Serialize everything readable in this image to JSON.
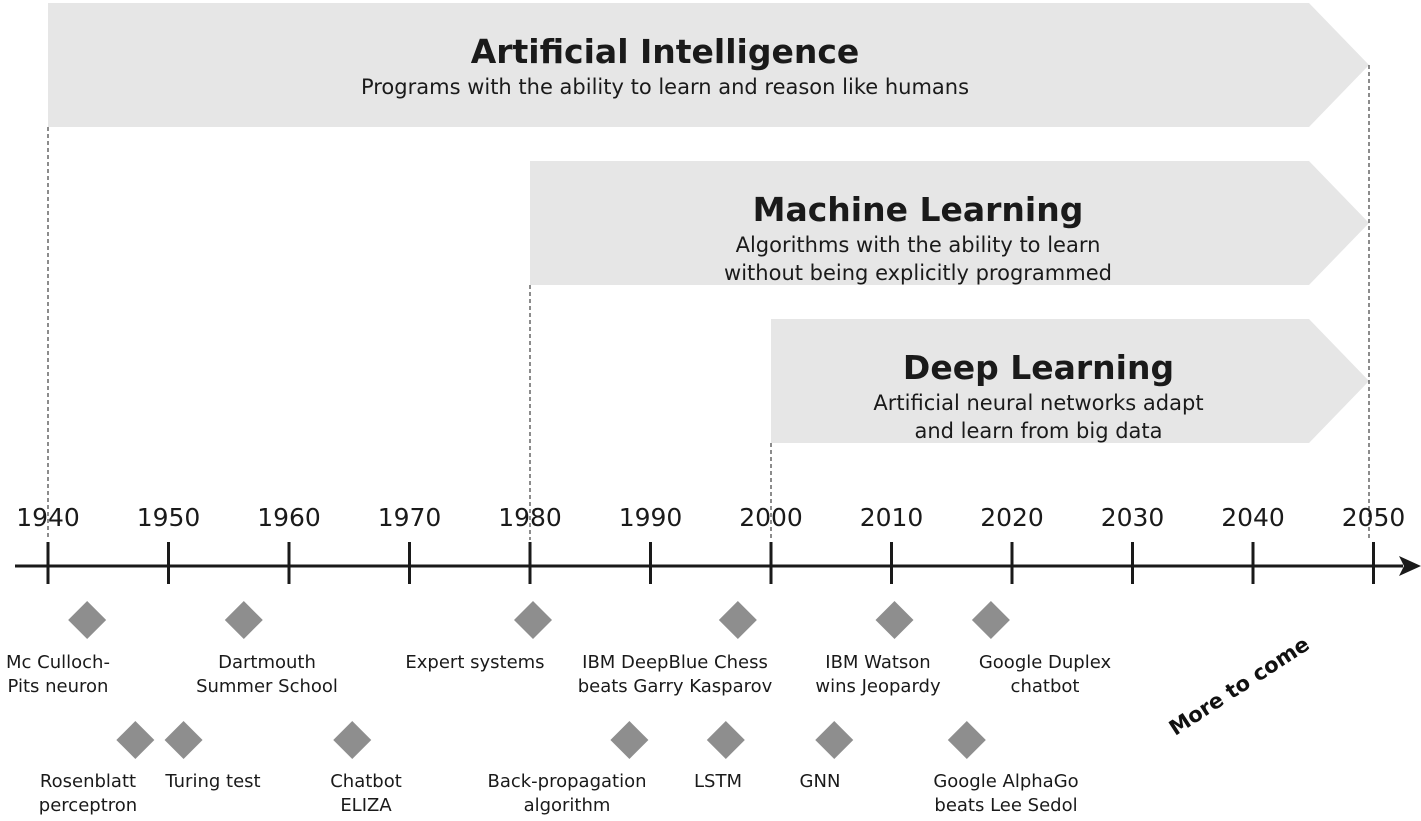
{
  "banners": [
    {
      "id": "artificial-intelligence",
      "title": "Artificial Intelligence",
      "subtitle": [
        "Programs with the ability to learn and reason like humans"
      ],
      "start_year": 1940,
      "end_year": 2050
    },
    {
      "id": "machine-learning",
      "title": "Machine Learning",
      "subtitle": [
        "Algorithms with the ability to learn",
        "without being explicitly programmed"
      ],
      "start_year": 1980,
      "end_year": 2050
    },
    {
      "id": "deep-learning",
      "title": "Deep Learning",
      "subtitle": [
        "Artificial neural networks adapt",
        "and learn from big data"
      ],
      "start_year": 2000,
      "end_year": 2050
    }
  ],
  "timeline": {
    "years": [
      "1940",
      "1950",
      "1960",
      "1970",
      "1980",
      "1990",
      "2000",
      "2010",
      "2020",
      "2030",
      "2040",
      "2050"
    ]
  },
  "events": [
    {
      "id": "mcculloch-pitts",
      "year": 1943,
      "row": "upper",
      "lines": [
        "Mc Culloch-",
        "Pits neuron"
      ]
    },
    {
      "id": "dartmouth",
      "year": 1956,
      "row": "upper",
      "lines": [
        "Dartmouth",
        "Summer School"
      ]
    },
    {
      "id": "expert-systems",
      "year": 1980,
      "row": "upper",
      "lines": [
        "Expert systems"
      ]
    },
    {
      "id": "deepblue",
      "year": 1997,
      "row": "upper",
      "lines": [
        "IBM DeepBlue Chess",
        "beats Garry Kasparov"
      ]
    },
    {
      "id": "watson",
      "year": 2010,
      "row": "upper",
      "lines": [
        "IBM Watson",
        "wins Jeopardy"
      ]
    },
    {
      "id": "duplex",
      "year": 2018,
      "row": "upper",
      "lines": [
        "Google Duplex",
        "chatbot"
      ]
    },
    {
      "id": "perceptron",
      "year": 1947,
      "row": "lower",
      "lines": [
        "Rosenblatt",
        "perceptron"
      ]
    },
    {
      "id": "turing",
      "year": 1951,
      "row": "lower",
      "lines": [
        "Turing test"
      ]
    },
    {
      "id": "eliza",
      "year": 1965,
      "row": "lower",
      "lines": [
        "Chatbot",
        "ELIZA"
      ]
    },
    {
      "id": "backprop",
      "year": 1988,
      "row": "lower",
      "lines": [
        "Back-propagation",
        "algorithm"
      ]
    },
    {
      "id": "lstm",
      "year": 1996,
      "row": "lower",
      "lines": [
        "LSTM"
      ]
    },
    {
      "id": "gnn",
      "year": 2005,
      "row": "lower",
      "lines": [
        "GNN"
      ]
    },
    {
      "id": "alphago",
      "year": 2016,
      "row": "lower",
      "lines": [
        "Google AlphaGo",
        "beats Lee Sedol"
      ]
    }
  ],
  "annotation": {
    "text": "More to come"
  },
  "colors": {
    "banner_fill": "#e6e6e6",
    "diamond_fill": "#8e8e8e",
    "axis": "#1a1a1a",
    "text": "#1a1a1a"
  }
}
